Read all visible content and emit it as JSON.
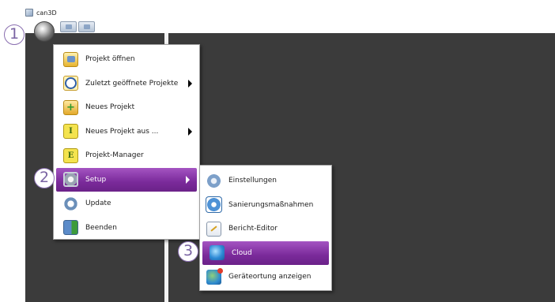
{
  "window": {
    "title": "can3D"
  },
  "markers": [
    "1",
    "2",
    "3"
  ],
  "main_menu": {
    "items": [
      {
        "label": "Projekt öffnen",
        "icon": "folder-open-icon",
        "submenu": false,
        "highlighted": false
      },
      {
        "label": "Zuletzt geöffnete Projekte",
        "icon": "recent-clock-icon",
        "submenu": true,
        "highlighted": false
      },
      {
        "label": "Neues Projekt",
        "icon": "new-folder-icon",
        "submenu": false,
        "highlighted": false
      },
      {
        "label": "Neues Projekt aus ...",
        "icon": "template-i-icon",
        "submenu": true,
        "highlighted": false
      },
      {
        "label": "Projekt-Manager",
        "icon": "project-manager-e-icon",
        "submenu": false,
        "highlighted": false
      },
      {
        "label": "Setup",
        "icon": "gear-icon",
        "submenu": true,
        "highlighted": true
      },
      {
        "label": "Update",
        "icon": "update-arrows-icon",
        "submenu": false,
        "highlighted": false
      },
      {
        "label": "Beenden",
        "icon": "exit-door-icon",
        "submenu": false,
        "highlighted": false
      }
    ]
  },
  "setup_submenu": {
    "items": [
      {
        "label": "Einstellungen",
        "icon": "settings-gears-icon",
        "highlighted": false
      },
      {
        "label": "Sanierungsmaßnahmen",
        "icon": "renovation-measures-icon",
        "highlighted": false
      },
      {
        "label": "Bericht-Editor",
        "icon": "report-editor-icon",
        "highlighted": false
      },
      {
        "label": "Cloud",
        "icon": "cloud-globe-icon",
        "highlighted": true
      },
      {
        "label": "Geräteortung anzeigen",
        "icon": "device-location-globe-icon",
        "highlighted": false
      }
    ]
  },
  "colors": {
    "highlight": "#8a3aaa",
    "workspace": "#3b3b3b",
    "marker_border": "#8a6fb0"
  }
}
